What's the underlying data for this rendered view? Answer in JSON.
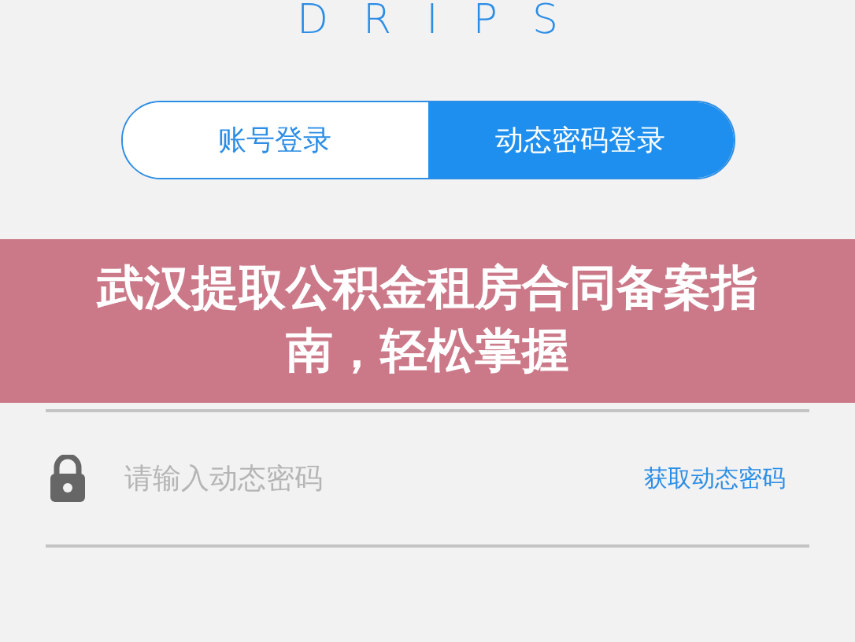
{
  "logo": "DRIPS",
  "tabs": [
    {
      "label": "账号登录",
      "selected": false
    },
    {
      "label": "动态密码登录",
      "selected": true
    }
  ],
  "password_field": {
    "placeholder": "请输入动态密码",
    "action": "获取动态密码"
  },
  "banner": {
    "title": "武汉提取公积金租房合同备案指南，轻松掌握"
  }
}
